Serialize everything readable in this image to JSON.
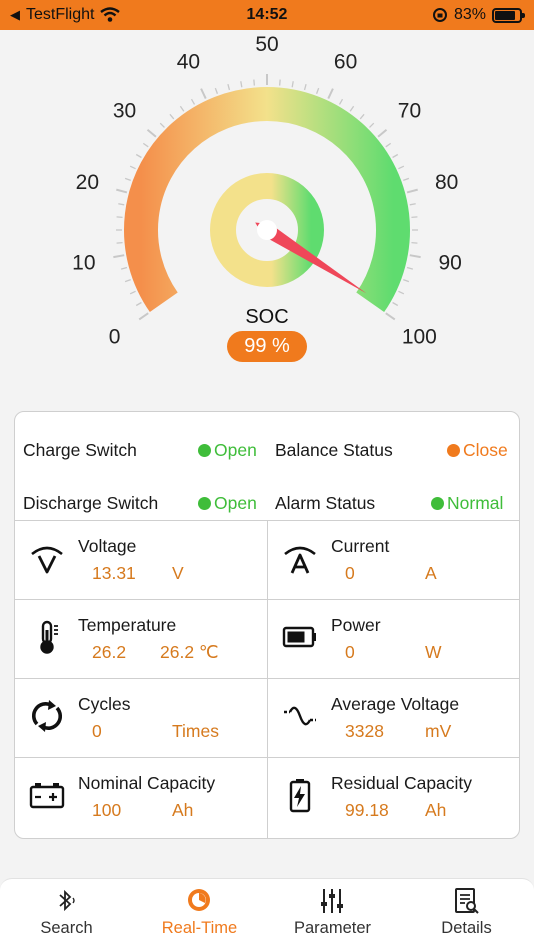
{
  "status_bar": {
    "back_app": "TestFlight",
    "time": "14:52",
    "battery": "83%",
    "battery_level": 0.83
  },
  "gauge": {
    "label": "SOC",
    "value_text": "99 %",
    "value": 99,
    "min": 0,
    "max": 100,
    "ticks": [
      "0",
      "10",
      "20",
      "30",
      "40",
      "50",
      "60",
      "70",
      "80",
      "90",
      "100"
    ],
    "colors": {
      "low": "#f48f4b",
      "mid": "#f3e18b",
      "high": "#5fdc6f",
      "needle": "#ef4759"
    }
  },
  "switches": [
    {
      "label": "Charge Switch",
      "value": "Open",
      "state": "green"
    },
    {
      "label": "Balance Status",
      "value": "Close",
      "state": "orange"
    },
    {
      "label": "Discharge Switch",
      "value": "Open",
      "state": "green"
    },
    {
      "label": "Alarm Status",
      "value": "Normal",
      "state": "green"
    }
  ],
  "metrics": [
    {
      "title": "Voltage",
      "value": "13.31",
      "unit": "V",
      "icon": "voltage-icon"
    },
    {
      "title": "Current",
      "value": "0",
      "unit": "A",
      "icon": "current-icon"
    },
    {
      "title": "Temperature",
      "value": "26.2",
      "unit": "26.2  ℃",
      "icon": "thermometer-icon"
    },
    {
      "title": "Power",
      "value": "0",
      "unit": "W",
      "icon": "battery-power-icon"
    },
    {
      "title": "Cycles",
      "value": "0",
      "unit": "Times",
      "icon": "cycles-icon"
    },
    {
      "title": "Average Voltage",
      "value": "3328",
      "unit": "mV",
      "icon": "sine-wave-icon"
    },
    {
      "title": "Nominal Capacity",
      "value": "100",
      "unit": "Ah",
      "icon": "battery-terminal-icon"
    },
    {
      "title": "Residual Capacity",
      "value": "99.18",
      "unit": "Ah",
      "icon": "battery-charge-icon"
    }
  ],
  "tabs": [
    {
      "label": "Search",
      "icon": "bluetooth-icon",
      "active": false
    },
    {
      "label": "Real-Time",
      "icon": "realtime-icon",
      "active": true
    },
    {
      "label": "Parameter",
      "icon": "sliders-icon",
      "active": false
    },
    {
      "label": "Details",
      "icon": "details-icon",
      "active": false
    }
  ],
  "accent": "#f07a1d"
}
